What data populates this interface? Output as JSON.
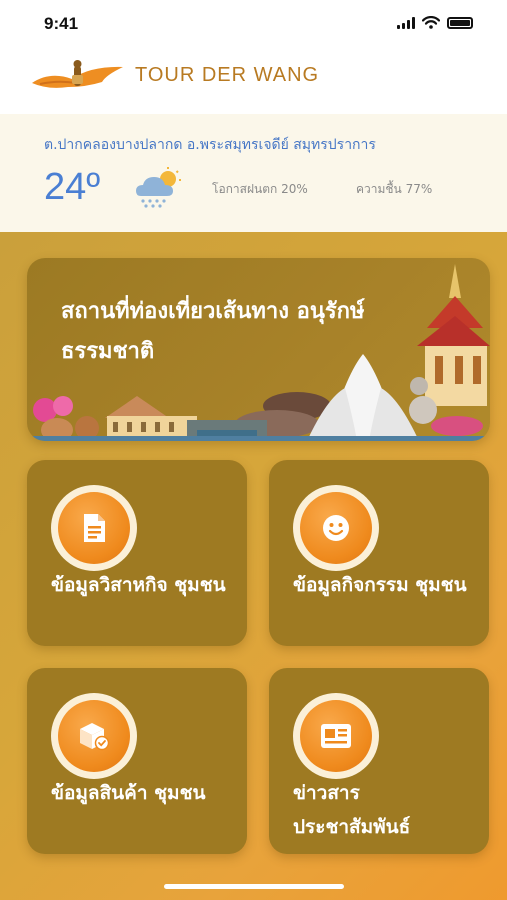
{
  "status_bar": {
    "time": "9:41"
  },
  "header": {
    "brand": "TOUR DER WANG"
  },
  "weather": {
    "location": "ต.ปากคลองบางปลากด อ.พระสมุทรเจดีย์ สมุทรปราการ",
    "temperature": "24º",
    "rain_text": "โอกาสฝนตก  20%",
    "humidity_text": "ความชื้น 77%",
    "icon": "cloud-rain-sun-icon"
  },
  "banner": {
    "title": "สถานที่ท่องเที่ยวเส้นทาง อนุรักษ์ธรรมชาติ"
  },
  "cards": [
    {
      "label": "ข้อมูลวิสาหกิจ ชุมชน",
      "icon": "document-icon"
    },
    {
      "label": "ข้อมูลกิจกรรม ชุมชน",
      "icon": "smile-icon"
    },
    {
      "label": "ข้อมูลสินค้า ชุมชน",
      "icon": "package-icon"
    },
    {
      "label": "ข่าวสาร ประชาสัมพันธ์",
      "icon": "news-icon"
    }
  ],
  "colors": {
    "brand": "#b87a22",
    "accent_blue": "#4a7fd3",
    "card_bg": "#9e7a22",
    "icon_orange": "#ef8a1d"
  }
}
